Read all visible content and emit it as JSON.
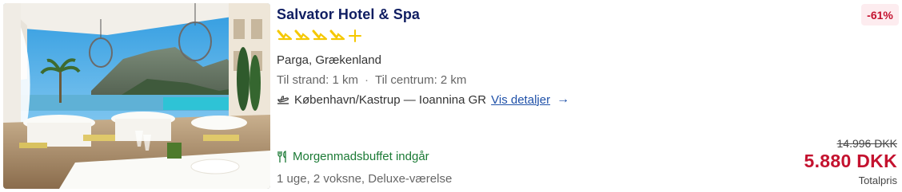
{
  "hotel": {
    "name": "Salvator Hotel & Spa",
    "rating": 4.5,
    "location": "Parga, Grækenland",
    "distance_beach": "Til strand: 1 km",
    "distance_center": "Til centrum: 2 km",
    "separator": "·"
  },
  "flight": {
    "route": "København/Kastrup — Ioannina GR",
    "details_link": "Vis detaljer",
    "arrow": "→"
  },
  "meal": {
    "label": "Morgenmadsbuffet indgår"
  },
  "trip": {
    "summary": "1 uge, 2 voksne, Deluxe-værelse"
  },
  "pricing": {
    "discount": "-61%",
    "old_price": "14.996 DKK",
    "new_price": "5.880 DKK",
    "label": "Totalpris"
  },
  "icons": {
    "plane": "plane-icon",
    "fork": "cutlery-icon",
    "star": "star-icon"
  },
  "colors": {
    "title": "#101e62",
    "star": "#f5c800",
    "discount_text": "#c4122f",
    "discount_bg": "#fdecef",
    "meal": "#1b7a35",
    "link": "#1e50a8"
  }
}
